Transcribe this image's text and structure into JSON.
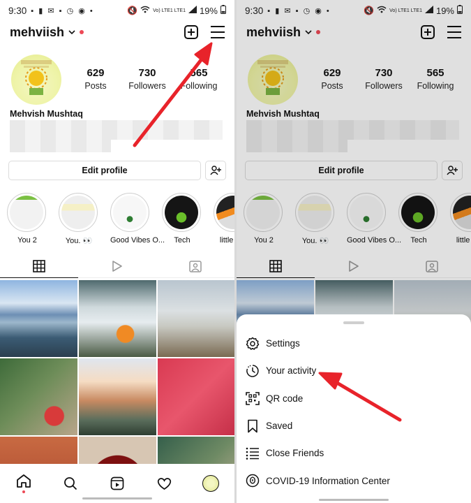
{
  "status_bar": {
    "time": "9:30",
    "network": "Vo) LTE1 LTE1",
    "battery": "19%"
  },
  "profile": {
    "username": "mehviish",
    "full_name": "Mehvish Mushtaq",
    "stats": [
      {
        "value": "629",
        "label": "Posts"
      },
      {
        "value": "730",
        "label": "Followers"
      },
      {
        "value": "565",
        "label": "Following"
      }
    ],
    "edit_profile_label": "Edit profile"
  },
  "highlights": [
    {
      "label": "You 2"
    },
    {
      "label": "You. 👀"
    },
    {
      "label": "Good Vibes O..."
    },
    {
      "label": "Tech"
    },
    {
      "label": "little thin"
    }
  ],
  "menu": {
    "items": [
      {
        "label": "Settings",
        "icon": "settings-icon"
      },
      {
        "label": "Your activity",
        "icon": "activity-icon"
      },
      {
        "label": "QR code",
        "icon": "qr-code-icon"
      },
      {
        "label": "Saved",
        "icon": "bookmark-icon"
      },
      {
        "label": "Close Friends",
        "icon": "close-friends-icon"
      },
      {
        "label": "COVID-19 Information Center",
        "icon": "covid-info-icon"
      }
    ]
  },
  "colors": {
    "notification_dot": "#ed4956",
    "annotation_arrow": "#e8232a"
  }
}
